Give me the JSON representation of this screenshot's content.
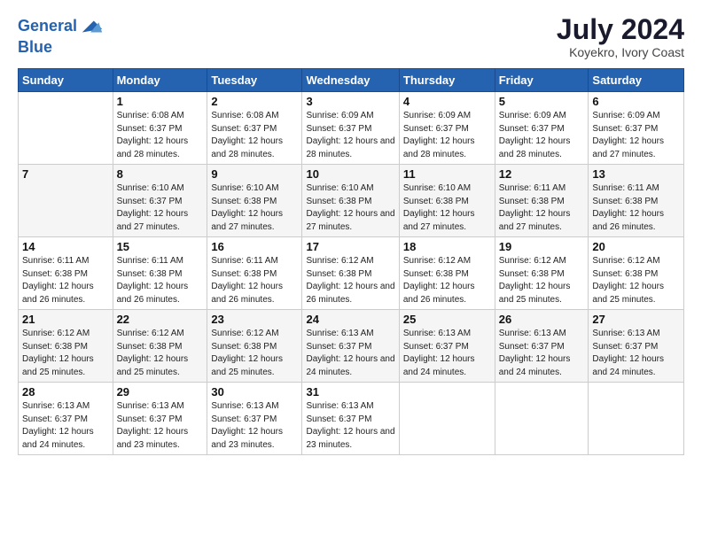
{
  "header": {
    "logo_line1": "General",
    "logo_line2": "Blue",
    "month_year": "July 2024",
    "location": "Koyekro, Ivory Coast"
  },
  "days_of_week": [
    "Sunday",
    "Monday",
    "Tuesday",
    "Wednesday",
    "Thursday",
    "Friday",
    "Saturday"
  ],
  "weeks": [
    [
      {
        "day": "",
        "info": ""
      },
      {
        "day": "1",
        "info": "Sunrise: 6:08 AM\nSunset: 6:37 PM\nDaylight: 12 hours and 28 minutes."
      },
      {
        "day": "2",
        "info": "Sunrise: 6:08 AM\nSunset: 6:37 PM\nDaylight: 12 hours and 28 minutes."
      },
      {
        "day": "3",
        "info": "Sunrise: 6:09 AM\nSunset: 6:37 PM\nDaylight: 12 hours and 28 minutes."
      },
      {
        "day": "4",
        "info": "Sunrise: 6:09 AM\nSunset: 6:37 PM\nDaylight: 12 hours and 28 minutes."
      },
      {
        "day": "5",
        "info": "Sunrise: 6:09 AM\nSunset: 6:37 PM\nDaylight: 12 hours and 28 minutes."
      },
      {
        "day": "6",
        "info": "Sunrise: 6:09 AM\nSunset: 6:37 PM\nDaylight: 12 hours and 27 minutes."
      }
    ],
    [
      {
        "day": "7",
        "info": ""
      },
      {
        "day": "8",
        "info": "Sunrise: 6:10 AM\nSunset: 6:37 PM\nDaylight: 12 hours and 27 minutes."
      },
      {
        "day": "9",
        "info": "Sunrise: 6:10 AM\nSunset: 6:38 PM\nDaylight: 12 hours and 27 minutes."
      },
      {
        "day": "10",
        "info": "Sunrise: 6:10 AM\nSunset: 6:38 PM\nDaylight: 12 hours and 27 minutes."
      },
      {
        "day": "11",
        "info": "Sunrise: 6:10 AM\nSunset: 6:38 PM\nDaylight: 12 hours and 27 minutes."
      },
      {
        "day": "12",
        "info": "Sunrise: 6:11 AM\nSunset: 6:38 PM\nDaylight: 12 hours and 27 minutes."
      },
      {
        "day": "13",
        "info": "Sunrise: 6:11 AM\nSunset: 6:38 PM\nDaylight: 12 hours and 26 minutes."
      }
    ],
    [
      {
        "day": "14",
        "info": "Sunrise: 6:11 AM\nSunset: 6:38 PM\nDaylight: 12 hours and 26 minutes."
      },
      {
        "day": "15",
        "info": "Sunrise: 6:11 AM\nSunset: 6:38 PM\nDaylight: 12 hours and 26 minutes."
      },
      {
        "day": "16",
        "info": "Sunrise: 6:11 AM\nSunset: 6:38 PM\nDaylight: 12 hours and 26 minutes."
      },
      {
        "day": "17",
        "info": "Sunrise: 6:12 AM\nSunset: 6:38 PM\nDaylight: 12 hours and 26 minutes."
      },
      {
        "day": "18",
        "info": "Sunrise: 6:12 AM\nSunset: 6:38 PM\nDaylight: 12 hours and 26 minutes."
      },
      {
        "day": "19",
        "info": "Sunrise: 6:12 AM\nSunset: 6:38 PM\nDaylight: 12 hours and 25 minutes."
      },
      {
        "day": "20",
        "info": "Sunrise: 6:12 AM\nSunset: 6:38 PM\nDaylight: 12 hours and 25 minutes."
      }
    ],
    [
      {
        "day": "21",
        "info": "Sunrise: 6:12 AM\nSunset: 6:38 PM\nDaylight: 12 hours and 25 minutes."
      },
      {
        "day": "22",
        "info": "Sunrise: 6:12 AM\nSunset: 6:38 PM\nDaylight: 12 hours and 25 minutes."
      },
      {
        "day": "23",
        "info": "Sunrise: 6:12 AM\nSunset: 6:38 PM\nDaylight: 12 hours and 25 minutes."
      },
      {
        "day": "24",
        "info": "Sunrise: 6:13 AM\nSunset: 6:37 PM\nDaylight: 12 hours and 24 minutes."
      },
      {
        "day": "25",
        "info": "Sunrise: 6:13 AM\nSunset: 6:37 PM\nDaylight: 12 hours and 24 minutes."
      },
      {
        "day": "26",
        "info": "Sunrise: 6:13 AM\nSunset: 6:37 PM\nDaylight: 12 hours and 24 minutes."
      },
      {
        "day": "27",
        "info": "Sunrise: 6:13 AM\nSunset: 6:37 PM\nDaylight: 12 hours and 24 minutes."
      }
    ],
    [
      {
        "day": "28",
        "info": "Sunrise: 6:13 AM\nSunset: 6:37 PM\nDaylight: 12 hours and 24 minutes."
      },
      {
        "day": "29",
        "info": "Sunrise: 6:13 AM\nSunset: 6:37 PM\nDaylight: 12 hours and 23 minutes."
      },
      {
        "day": "30",
        "info": "Sunrise: 6:13 AM\nSunset: 6:37 PM\nDaylight: 12 hours and 23 minutes."
      },
      {
        "day": "31",
        "info": "Sunrise: 6:13 AM\nSunset: 6:37 PM\nDaylight: 12 hours and 23 minutes."
      },
      {
        "day": "",
        "info": ""
      },
      {
        "day": "",
        "info": ""
      },
      {
        "day": "",
        "info": ""
      }
    ]
  ]
}
